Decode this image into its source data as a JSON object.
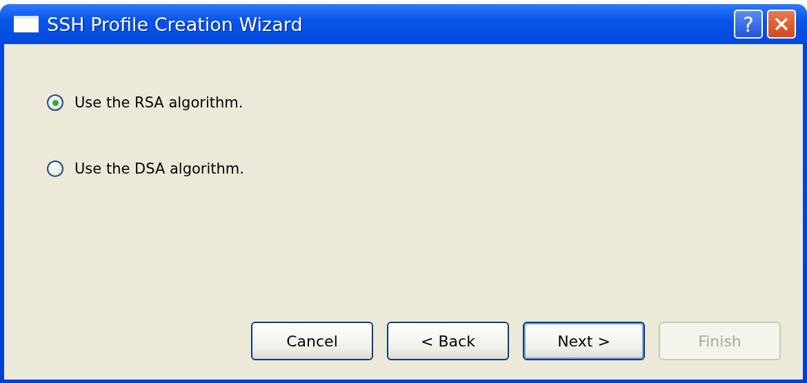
{
  "window": {
    "title": "SSH Profile Creation Wizard",
    "title_buttons": [
      {
        "kind": "help",
        "label": "?"
      },
      {
        "kind": "close"
      }
    ]
  },
  "options": [
    {
      "label": "Use the RSA algorithm.",
      "selected": true
    },
    {
      "label": "Use the DSA algorithm.",
      "selected": false
    }
  ],
  "buttons": [
    {
      "label": "Cancel",
      "disabled": false,
      "default": false
    },
    {
      "label": "< Back",
      "disabled": false,
      "default": false
    },
    {
      "label": "Next >",
      "disabled": false,
      "default": true
    },
    {
      "label": "Finish",
      "disabled": true,
      "default": false
    }
  ]
}
